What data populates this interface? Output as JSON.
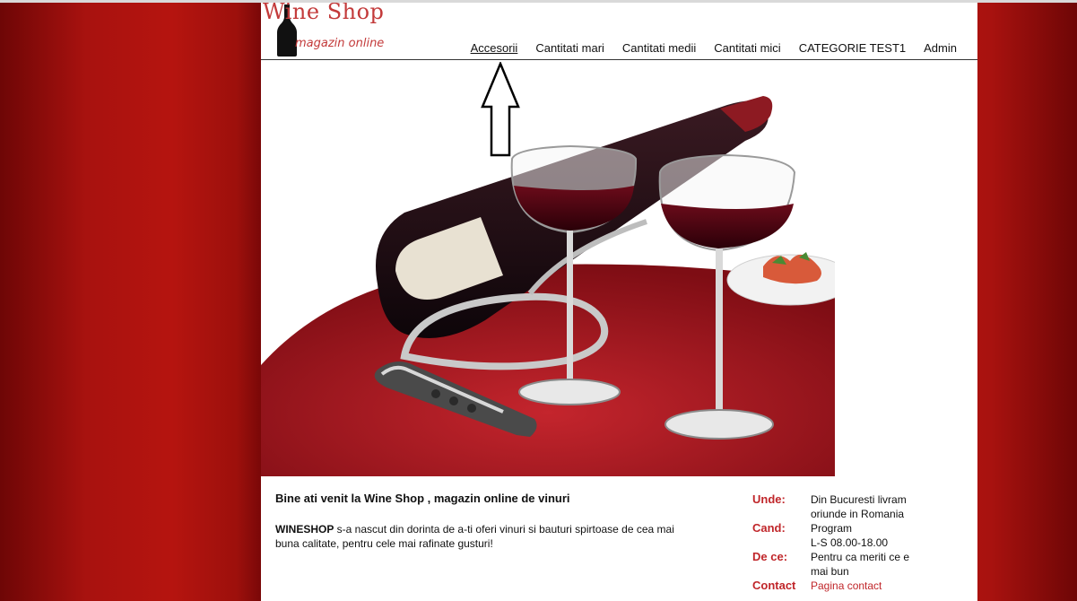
{
  "brand": {
    "title": "Wine Shop",
    "subtitle": "magazin online"
  },
  "nav": {
    "items": [
      {
        "label": "Accesorii",
        "active": true
      },
      {
        "label": "Cantitati mari",
        "active": false
      },
      {
        "label": "Cantitati medii",
        "active": false
      },
      {
        "label": "Cantitati mici",
        "active": false
      },
      {
        "label": "CATEGORIE TEST1",
        "active": false
      },
      {
        "label": "Admin",
        "active": false
      }
    ]
  },
  "welcome": {
    "heading": "Bine ati venit la Wine Shop , magazin online de vinuri",
    "brand_word": "WINESHOP",
    "body": " s-a nascut din dorinta de a-ti oferi vinuri si bauturi spirtoase de cea mai buna calitate, pentru cele mai rafinate gusturi!"
  },
  "info": {
    "unde_label": "Unde:",
    "unde_value": "Din Bucuresti livram oriunde in Romania",
    "cand_label": "Cand:",
    "cand_value_1": "Program",
    "cand_value_2": "L-S 08.00-18.00",
    "dece_label": "De ce:",
    "dece_value": "Pentru ca meriti ce e mai bun",
    "contact_label": "Contact",
    "contact_value": "Pagina contact"
  },
  "colors": {
    "brand_red": "#c33a3a",
    "label_red": "#c0262a",
    "tablecloth": "#a81b24"
  }
}
